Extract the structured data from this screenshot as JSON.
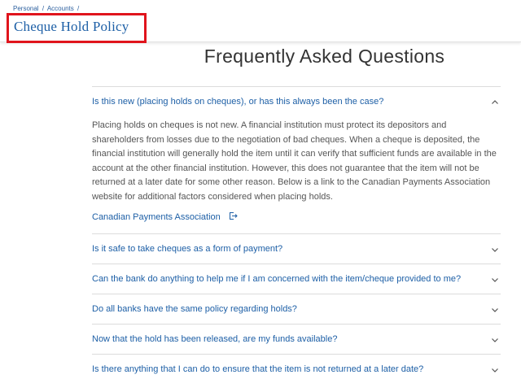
{
  "breadcrumb": [
    "Personal",
    "/",
    "Accounts",
    "/"
  ],
  "page_title": "Cheque Hold Policy",
  "faq_heading": "Frequently Asked Questions",
  "faq": [
    {
      "question": "Is this new (placing holds on cheques), or has this always been the case?",
      "answer": "Placing holds on cheques is not new. A financial institution must protect its depositors and shareholders from losses due to the negotiation of bad cheques. When a cheque is deposited, the financial institution will generally hold the item until it can verify that sufficient funds are available in the account at the other financial institution. However, this does not guarantee that the item will not be returned at a later date for some other reason. Below is a link to the Canadian Payments Association website for additional factors considered when placing holds.",
      "link": "Canadian Payments Association"
    },
    {
      "question": "Is it safe to take cheques as a form of payment?"
    },
    {
      "question": "Can the bank do anything to help me if I am concerned with the item/cheque provided to me?"
    },
    {
      "question": "Do all banks have the same policy regarding holds?"
    },
    {
      "question": "Now that the hold has been released, are my funds available?"
    },
    {
      "question": "Is there anything that I can do to ensure that the item is not returned at a later date?"
    }
  ],
  "colors": {
    "accent": "#1d5fa6",
    "highlight_box": "#e0141c"
  }
}
